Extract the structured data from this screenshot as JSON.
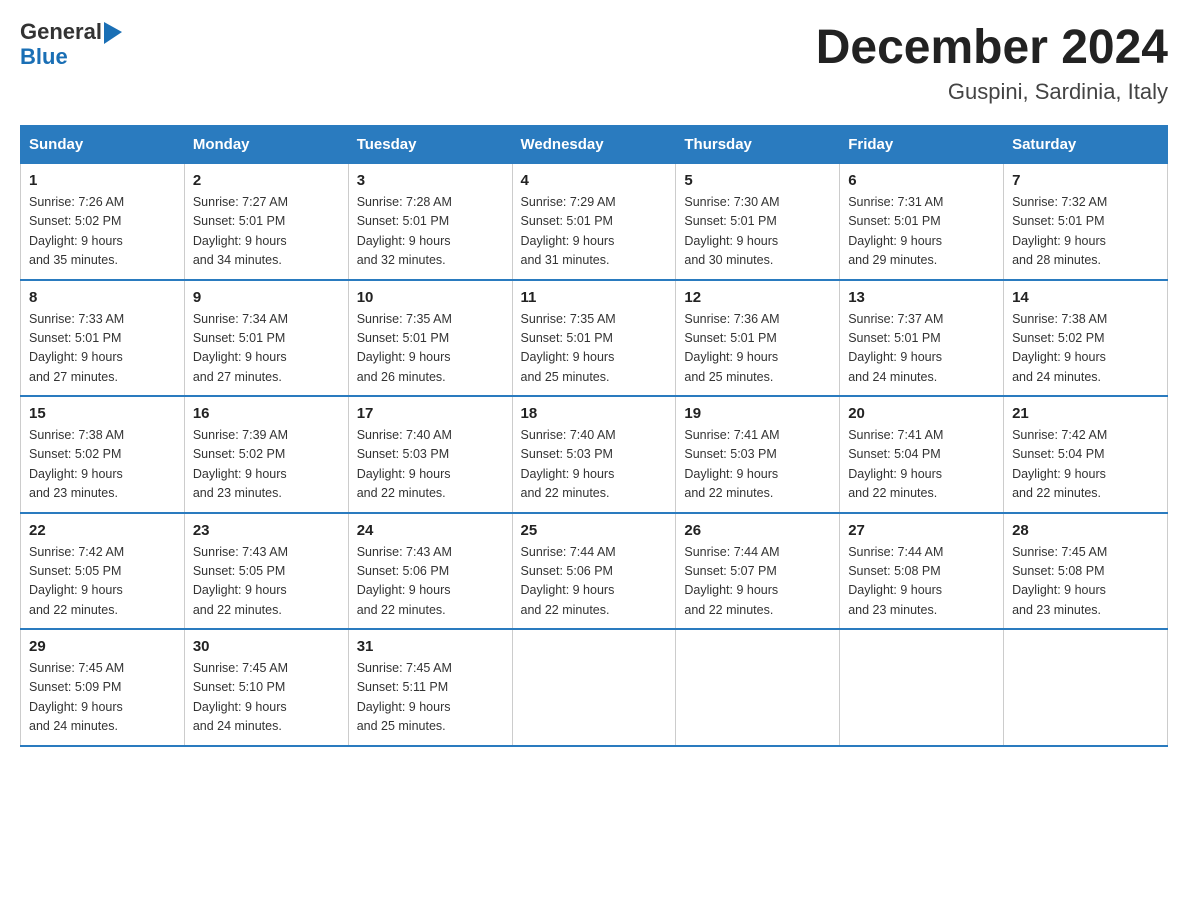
{
  "logo": {
    "line1": "General",
    "arrow": "▶",
    "line2": "Blue"
  },
  "title": "December 2024",
  "subtitle": "Guspini, Sardinia, Italy",
  "weekdays": [
    "Sunday",
    "Monday",
    "Tuesday",
    "Wednesday",
    "Thursday",
    "Friday",
    "Saturday"
  ],
  "weeks": [
    [
      {
        "day": "1",
        "sunrise": "7:26 AM",
        "sunset": "5:02 PM",
        "daylight": "9 hours and 35 minutes."
      },
      {
        "day": "2",
        "sunrise": "7:27 AM",
        "sunset": "5:01 PM",
        "daylight": "9 hours and 34 minutes."
      },
      {
        "day": "3",
        "sunrise": "7:28 AM",
        "sunset": "5:01 PM",
        "daylight": "9 hours and 32 minutes."
      },
      {
        "day": "4",
        "sunrise": "7:29 AM",
        "sunset": "5:01 PM",
        "daylight": "9 hours and 31 minutes."
      },
      {
        "day": "5",
        "sunrise": "7:30 AM",
        "sunset": "5:01 PM",
        "daylight": "9 hours and 30 minutes."
      },
      {
        "day": "6",
        "sunrise": "7:31 AM",
        "sunset": "5:01 PM",
        "daylight": "9 hours and 29 minutes."
      },
      {
        "day": "7",
        "sunrise": "7:32 AM",
        "sunset": "5:01 PM",
        "daylight": "9 hours and 28 minutes."
      }
    ],
    [
      {
        "day": "8",
        "sunrise": "7:33 AM",
        "sunset": "5:01 PM",
        "daylight": "9 hours and 27 minutes."
      },
      {
        "day": "9",
        "sunrise": "7:34 AM",
        "sunset": "5:01 PM",
        "daylight": "9 hours and 27 minutes."
      },
      {
        "day": "10",
        "sunrise": "7:35 AM",
        "sunset": "5:01 PM",
        "daylight": "9 hours and 26 minutes."
      },
      {
        "day": "11",
        "sunrise": "7:35 AM",
        "sunset": "5:01 PM",
        "daylight": "9 hours and 25 minutes."
      },
      {
        "day": "12",
        "sunrise": "7:36 AM",
        "sunset": "5:01 PM",
        "daylight": "9 hours and 25 minutes."
      },
      {
        "day": "13",
        "sunrise": "7:37 AM",
        "sunset": "5:01 PM",
        "daylight": "9 hours and 24 minutes."
      },
      {
        "day": "14",
        "sunrise": "7:38 AM",
        "sunset": "5:02 PM",
        "daylight": "9 hours and 24 minutes."
      }
    ],
    [
      {
        "day": "15",
        "sunrise": "7:38 AM",
        "sunset": "5:02 PM",
        "daylight": "9 hours and 23 minutes."
      },
      {
        "day": "16",
        "sunrise": "7:39 AM",
        "sunset": "5:02 PM",
        "daylight": "9 hours and 23 minutes."
      },
      {
        "day": "17",
        "sunrise": "7:40 AM",
        "sunset": "5:03 PM",
        "daylight": "9 hours and 22 minutes."
      },
      {
        "day": "18",
        "sunrise": "7:40 AM",
        "sunset": "5:03 PM",
        "daylight": "9 hours and 22 minutes."
      },
      {
        "day": "19",
        "sunrise": "7:41 AM",
        "sunset": "5:03 PM",
        "daylight": "9 hours and 22 minutes."
      },
      {
        "day": "20",
        "sunrise": "7:41 AM",
        "sunset": "5:04 PM",
        "daylight": "9 hours and 22 minutes."
      },
      {
        "day": "21",
        "sunrise": "7:42 AM",
        "sunset": "5:04 PM",
        "daylight": "9 hours and 22 minutes."
      }
    ],
    [
      {
        "day": "22",
        "sunrise": "7:42 AM",
        "sunset": "5:05 PM",
        "daylight": "9 hours and 22 minutes."
      },
      {
        "day": "23",
        "sunrise": "7:43 AM",
        "sunset": "5:05 PM",
        "daylight": "9 hours and 22 minutes."
      },
      {
        "day": "24",
        "sunrise": "7:43 AM",
        "sunset": "5:06 PM",
        "daylight": "9 hours and 22 minutes."
      },
      {
        "day": "25",
        "sunrise": "7:44 AM",
        "sunset": "5:06 PM",
        "daylight": "9 hours and 22 minutes."
      },
      {
        "day": "26",
        "sunrise": "7:44 AM",
        "sunset": "5:07 PM",
        "daylight": "9 hours and 22 minutes."
      },
      {
        "day": "27",
        "sunrise": "7:44 AM",
        "sunset": "5:08 PM",
        "daylight": "9 hours and 23 minutes."
      },
      {
        "day": "28",
        "sunrise": "7:45 AM",
        "sunset": "5:08 PM",
        "daylight": "9 hours and 23 minutes."
      }
    ],
    [
      {
        "day": "29",
        "sunrise": "7:45 AM",
        "sunset": "5:09 PM",
        "daylight": "9 hours and 24 minutes."
      },
      {
        "day": "30",
        "sunrise": "7:45 AM",
        "sunset": "5:10 PM",
        "daylight": "9 hours and 24 minutes."
      },
      {
        "day": "31",
        "sunrise": "7:45 AM",
        "sunset": "5:11 PM",
        "daylight": "9 hours and 25 minutes."
      },
      null,
      null,
      null,
      null
    ]
  ]
}
